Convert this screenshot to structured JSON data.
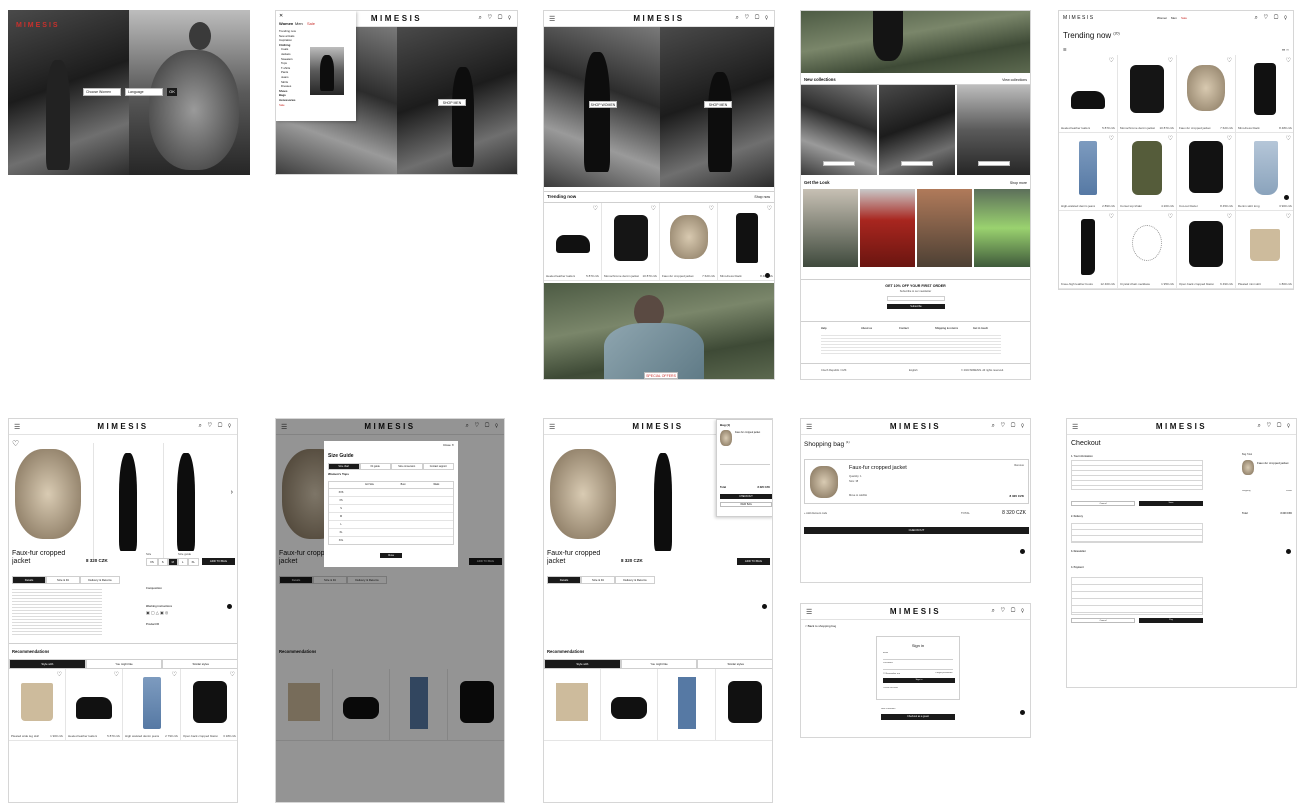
{
  "brand": "MIMESIS",
  "icons": {
    "header": "search-icon heart-icon bag-icon user-icon",
    "menu": "menu-icon"
  },
  "a1": {
    "brand": "MIMESIS",
    "select_a": "Choose Women",
    "select_b": "Language",
    "go": "OK"
  },
  "a2": {
    "nav": [
      "Women",
      "Men",
      "Sale"
    ],
    "menu": [
      "Trending now",
      "New arrivals",
      "Inspiration",
      "Clothing",
      "Coats",
      "Jackets",
      "Sweaters",
      "Tops",
      "T-shirts",
      "Pants",
      "Jeans",
      "Skirts",
      "Dresses",
      "Shoes",
      "Bags",
      "Accessories",
      "Sale"
    ],
    "btn": "SHOP MEN"
  },
  "a3": {
    "btn_a": "SHOP WOMEN",
    "btn_b": "SHOP MEN",
    "trending": "Trending now",
    "shop_now": "Shop now",
    "items": [
      {
        "name": "Heeled leather loafers",
        "price": "5 870 czk"
      },
      {
        "name": "Monochrome denim jacket",
        "price": "10 870 czk"
      },
      {
        "name": "Faux-fur cropped jacket",
        "price": "7 620 czk"
      },
      {
        "name": "Mini-dress black",
        "price": "8 480 czk"
      }
    ],
    "banner_btn": "SPECIAL OFFERS"
  },
  "a4": {
    "new_collections": "New collections",
    "view_collections": "View collections",
    "our_look": "Get the Look",
    "shop_more": "Shop more",
    "signup_title": "GET 10% OFF YOUR FIRST ORDER",
    "signup_sub": "Subscribe to our newsletter",
    "subscribe": "Subscribe",
    "footer_cols": [
      "Help",
      "About us",
      "Contact",
      "Shipping & returns",
      "Get in touch"
    ],
    "footer_bottom": [
      "Czech Republic / CZK",
      "English",
      "© 2023 MIMESIS. All rights reserved."
    ]
  },
  "a5": {
    "title": "Trending now",
    "count": "(20)",
    "nav": [
      "Women",
      "Men",
      "Sale"
    ],
    "items": [
      {
        "name": "Heeled leather loafers",
        "price": "5 870 czk"
      },
      {
        "name": "Monochrome denim jacket",
        "price": "10 870 czk"
      },
      {
        "name": "Faux-fur cropped jacket",
        "price": "7 620 czk"
      },
      {
        "name": "Mini-dress black",
        "price": "8 480 czk"
      },
      {
        "name": "High-waisted denim jeans",
        "price": "2 890 czk"
      },
      {
        "name": "Corset top khaki",
        "price": "4 200 czk"
      },
      {
        "name": "Cut-out blazer",
        "price": "8 450 czk"
      },
      {
        "name": "Denim skirt long",
        "price": "3 900 czk"
      },
      {
        "name": "Knee-high leather boots",
        "price": "12 400 czk"
      },
      {
        "name": "Crystal chain necklace",
        "price": "1 950 czk"
      },
      {
        "name": "Open back cropped blazer",
        "price": "6 490 czk"
      },
      {
        "name": "Pleated mini skirt",
        "price": "1 800 czk"
      }
    ]
  },
  "product": {
    "name": "Faux-fur cropped jacket",
    "price": "8 320 CZK",
    "size": "Size",
    "size_guide": "Size guide",
    "sizes": [
      "XS",
      "S",
      "M",
      "L",
      "XL"
    ],
    "add": "ADD TO BAG",
    "tabs": [
      "Details",
      "Size & Fit",
      "Delivery & Returns"
    ],
    "composition": "Composition",
    "washing": "Washing instructions",
    "product_id": "Product ID",
    "recommendations": "Recommendations",
    "rec_tabs": [
      "Style with",
      "You might like",
      "Similar styles"
    ],
    "rec_items": [
      {
        "name": "Pleated wide leg skirt",
        "price": "1 900 czk"
      },
      {
        "name": "Heeled leather loafers",
        "price": "5 870 czk"
      },
      {
        "name": "High waisted denim jeans",
        "price": "2 790 czk"
      },
      {
        "name": "Open back cropped blazer",
        "price": "3 180 czk"
      }
    ]
  },
  "size_guide": {
    "title": "Size Guide",
    "tabs": [
      "Size chart",
      "Fit guide",
      "Size conversion",
      "Contact support"
    ],
    "table_title": "Women's Tops",
    "cols": [
      "EU Size",
      "Bust",
      "Waist"
    ],
    "rows": [
      "XXS",
      "XS",
      "S",
      "M",
      "L",
      "XL",
      "XXL"
    ],
    "close": "Close"
  },
  "minibag": {
    "title": "Bag (1)",
    "item": "Faux-fur cropped jacket",
    "total": "Total",
    "total_val": "8 320 CZK",
    "checkout": "CHECKOUT",
    "view": "VIEW BAG"
  },
  "bag": {
    "title": "Shopping bag",
    "count": "(1)",
    "item": "Faux-fur cropped jacket",
    "qty": "Quantity: 1",
    "size": "Size: 38",
    "remove": "Remove",
    "move": "Move to wishlist",
    "price": "8 320 CZK",
    "discount": "+ Add discount code",
    "total_label": "TOTAL",
    "total": "8 320 CZK",
    "checkout": "CHECKOUT"
  },
  "signin": {
    "back": "< Back to shopping bag",
    "title": "Sign in",
    "email": "Email",
    "password": "Password",
    "remember": "Remember me",
    "forgot": "Forgot password?",
    "btn": "Sign in",
    "create": "Create account",
    "guest_label": "New customer?",
    "guest": "Checkout as a guest"
  },
  "checkout": {
    "title": "Checkout",
    "s1": "1. Your information",
    "s2": "2. Delivery",
    "s3": "3. Newsletter",
    "s4": "4. Payment",
    "cancel": "Cancel",
    "save": "Save",
    "pay": "Pay",
    "bag_total": "Bag Total",
    "item": "Faux-fur cropped jacket",
    "shipping": "Shipping",
    "shipping_val": "FREE",
    "total": "Total",
    "total_val": "8 320 CZK"
  }
}
